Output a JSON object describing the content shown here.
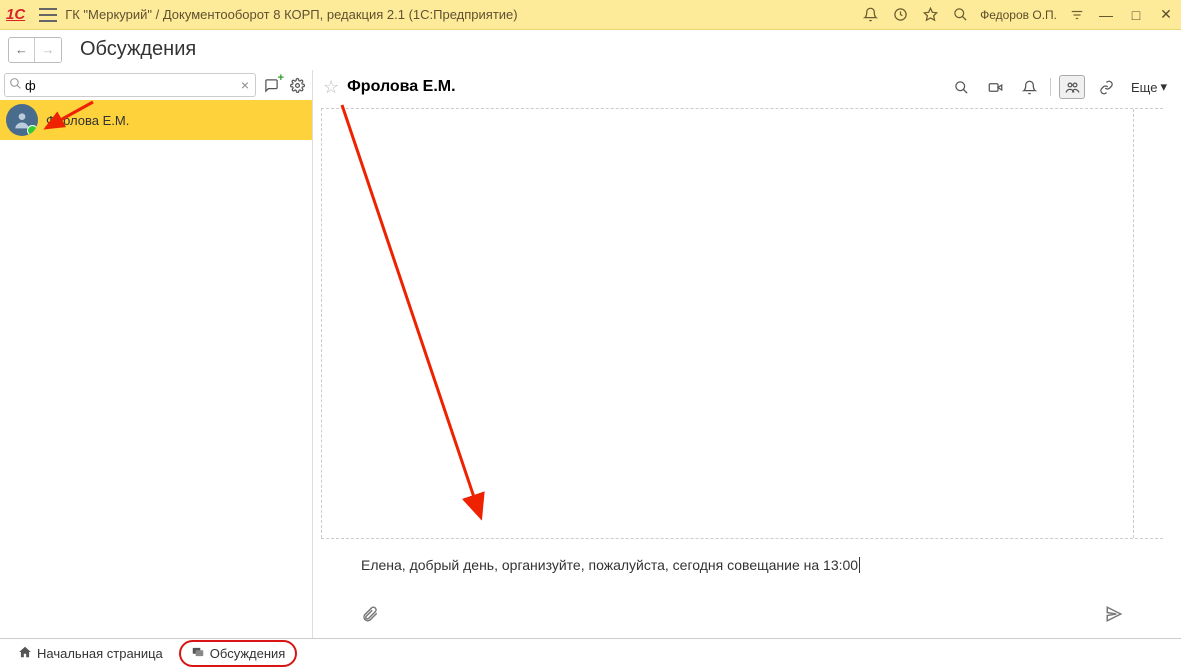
{
  "title": "ГК \"Меркурий\" / Документооборот 8 КОРП, редакция 2.1  (1С:Предприятие)",
  "user": "Федоров О.П.",
  "page_heading": "Обсуждения",
  "sidebar": {
    "search_value": "ф",
    "contact_name": "Фролова Е.М."
  },
  "chat": {
    "title": "Фролова Е.М.",
    "more_label": "Еще",
    "compose_text": "Елена, добрый день, организуйте, пожалуйста, сегодня совещание на 13:00"
  },
  "bottom": {
    "home": "Начальная страница",
    "discussions": "Обсуждения"
  }
}
